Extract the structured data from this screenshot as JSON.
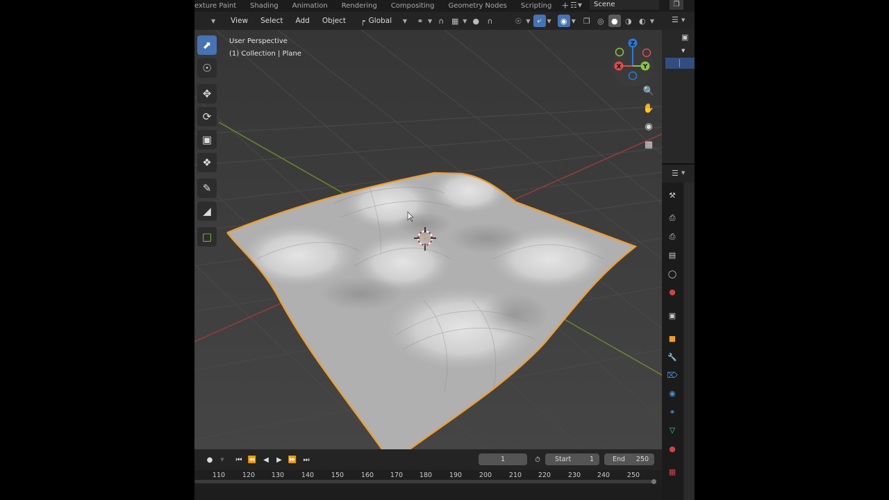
{
  "workspace_tabs": [
    "exture Paint",
    "Shading",
    "Animation",
    "Rendering",
    "Compositing",
    "Geometry Nodes",
    "Scripting"
  ],
  "scene": {
    "name": "Scene"
  },
  "header": {
    "menus": [
      "View",
      "Select",
      "Add",
      "Object"
    ],
    "transform_orientation": "Global"
  },
  "viewport": {
    "perspective": "User Perspective",
    "collection": "(1) Collection | Plane",
    "selection_color": "#f39c2a"
  },
  "toolbar": {
    "tools": [
      "select-box",
      "cursor",
      "move",
      "rotate",
      "scale",
      "transform",
      "annotate",
      "measure",
      "add-cube"
    ]
  },
  "gizmo": {
    "x": "X",
    "y": "Y",
    "z": "Z"
  },
  "timeline": {
    "current_frame": "1",
    "start_label": "Start",
    "start": "1",
    "end_label": "End",
    "end": "250",
    "ticks": [
      "110",
      "120",
      "130",
      "140",
      "150",
      "160",
      "170",
      "180",
      "190",
      "200",
      "210",
      "220",
      "230",
      "240",
      "250"
    ]
  }
}
